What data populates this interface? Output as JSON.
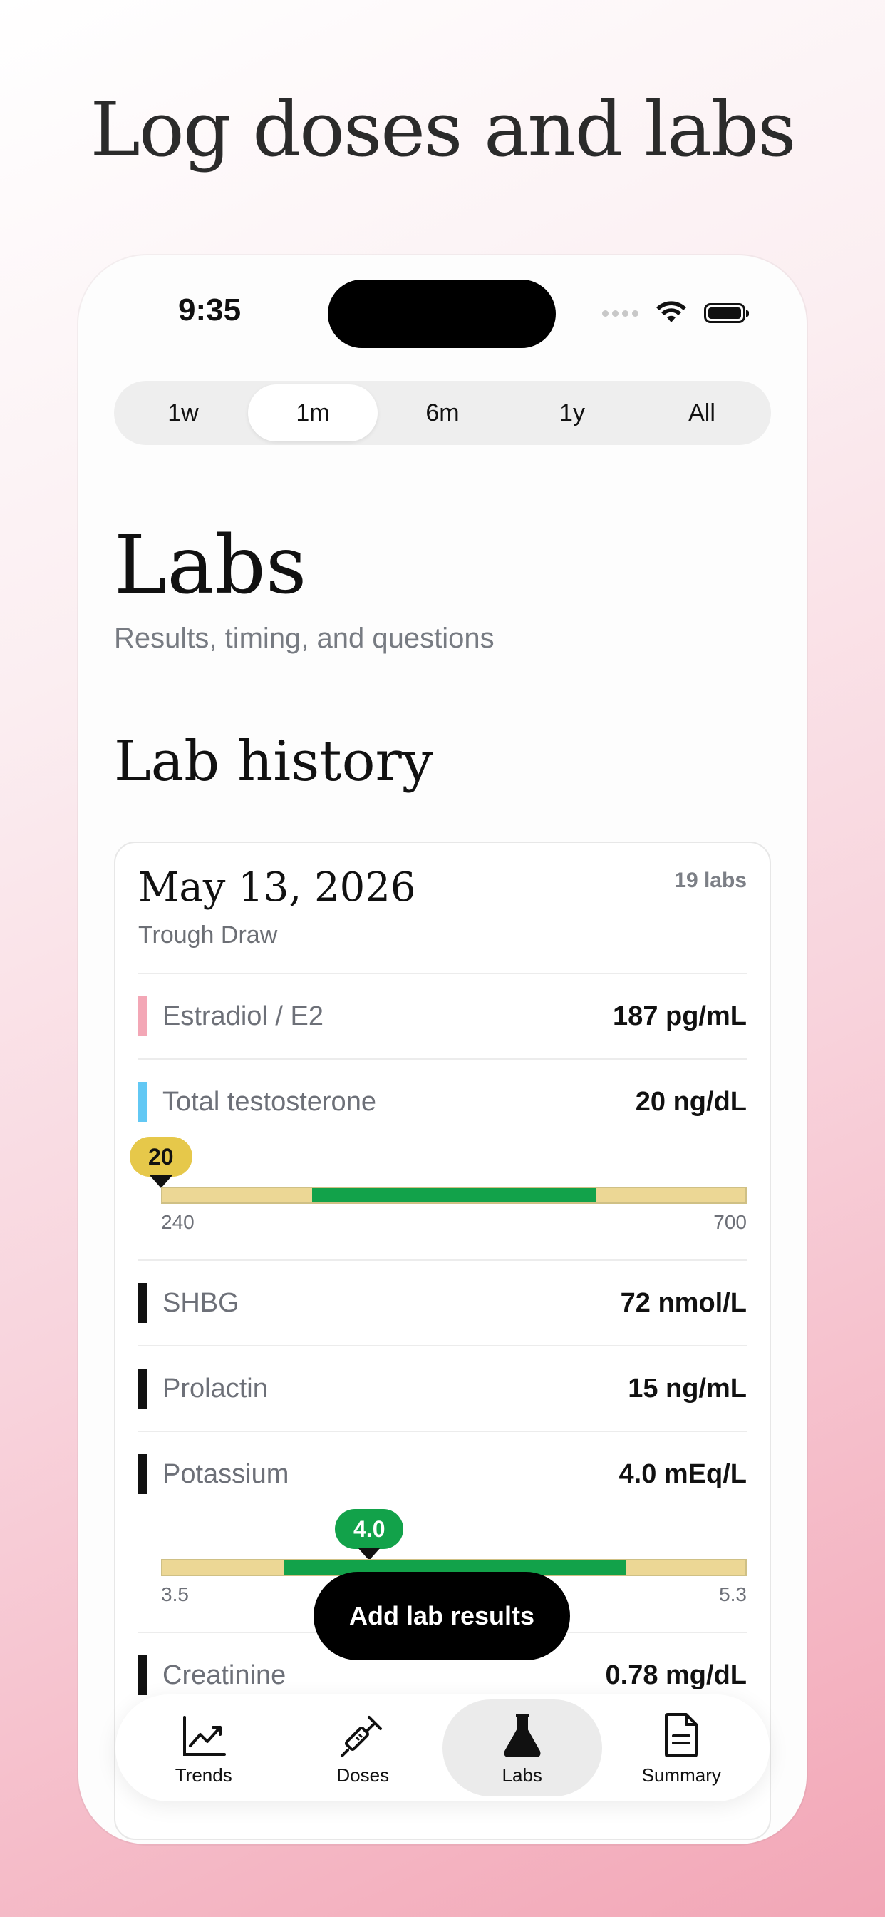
{
  "hero": {
    "title": "Log doses and labs"
  },
  "status": {
    "time": "9:35"
  },
  "range_tabs": [
    "1w",
    "1m",
    "6m",
    "1y",
    "All"
  ],
  "range_selected": "1m",
  "page": {
    "title": "Labs",
    "subtitle": "Results, timing, and questions"
  },
  "section": {
    "title": "Lab history"
  },
  "lab_entry": {
    "date": "May 13, 2026",
    "draw_type": "Trough Draw",
    "count": "19 labs",
    "results": [
      {
        "name": "Estradiol / E2",
        "value": "187 pg/mL",
        "color": "#f3a7b6"
      },
      {
        "name": "Total testosterone",
        "value": "20 ng/dL",
        "color": "#62c8f4",
        "range": {
          "value_label": "20",
          "low": "240",
          "high": "700",
          "status_color": "#e6c84a"
        }
      },
      {
        "name": "SHBG",
        "value": "72 nmol/L",
        "color": "#111111"
      },
      {
        "name": "Prolactin",
        "value": "15 ng/mL",
        "color": "#111111"
      },
      {
        "name": "Potassium",
        "value": "4.0 mEq/L",
        "color": "#111111",
        "range": {
          "value_label": "4.0",
          "low": "3.5",
          "high": "5.3",
          "status_color": "#12a24a"
        }
      },
      {
        "name": "Creatinine",
        "value": "0.78 mg/dL",
        "color": "#111111"
      }
    ]
  },
  "cta": {
    "label": "Add lab results"
  },
  "tabbar": {
    "items": [
      {
        "label": "Trends",
        "icon": "chart-trend-icon"
      },
      {
        "label": "Doses",
        "icon": "syringe-icon"
      },
      {
        "label": "Labs",
        "icon": "flask-icon"
      },
      {
        "label": "Summary",
        "icon": "document-icon"
      }
    ],
    "active": "Labs"
  }
}
